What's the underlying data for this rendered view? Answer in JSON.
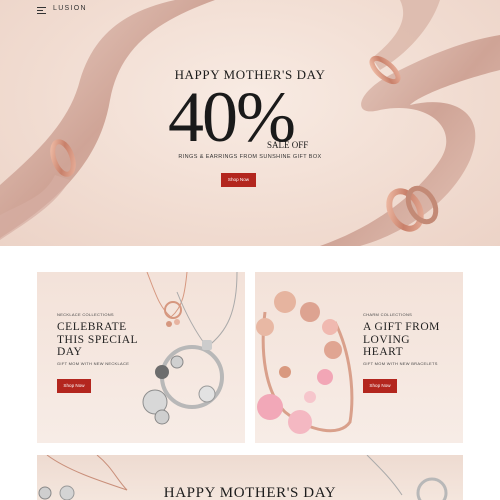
{
  "header": {
    "brand": "LUSION",
    "menu_icon": "hamburger-menu-icon"
  },
  "hero": {
    "title": "HAPPY MOTHER'S DAY",
    "percent": "40%",
    "sale_off": "SALE OFF",
    "subtitle": "RINGS & EARRINGS FROM SUNSHINE GIFT BOX",
    "button": "Shop Now"
  },
  "cards": [
    {
      "kicker": "NECKLACE COLLECTIONS",
      "heading": "CELEBRATE\nTHIS SPECIAL\nDAY",
      "desc": "GIFT MOM WITH NEW NECKLACE",
      "button": "Shop Now"
    },
    {
      "kicker": "CHARM COLLECTIONS",
      "heading": "A GIFT FROM\nLOVING\nHEART",
      "desc": "GIFT MOM WITH NEW BRACELETS",
      "button": "Shop Now"
    }
  ],
  "banner2": {
    "title": "HAPPY MOTHER'S DAY"
  },
  "colors": {
    "accent": "#b3261e",
    "hero_bg": "#f1dcd1",
    "rose_gold": "#d99a84"
  }
}
